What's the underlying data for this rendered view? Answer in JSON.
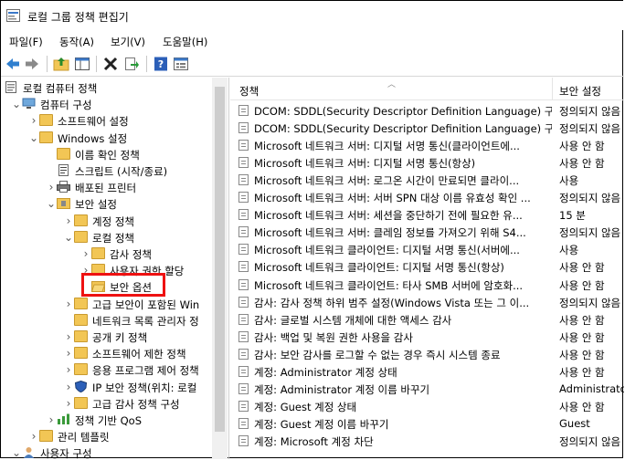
{
  "window": {
    "title": "로컬 그룹 정책 편집기"
  },
  "menu": [
    "파일(F)",
    "동작(A)",
    "보기(V)",
    "도움말(H)"
  ],
  "toolbar": [
    "back-icon",
    "forward-icon",
    "up-folder-icon",
    "show-hide-tree-icon",
    "delete-icon",
    "export-icon",
    "help-icon",
    "properties-icon"
  ],
  "tree": [
    {
      "label": "로컬 컴퓨터 정책",
      "indent": 0,
      "toggle": "",
      "icon": "computer-policy"
    },
    {
      "label": "컴퓨터 구성",
      "indent": 1,
      "toggle": "v",
      "icon": "computer"
    },
    {
      "label": "소프트웨어 설정",
      "indent": 2,
      "toggle": ">",
      "icon": "folder"
    },
    {
      "label": "Windows 설정",
      "indent": 2,
      "toggle": "v",
      "icon": "folder"
    },
    {
      "label": "이름 확인 정책",
      "indent": 3,
      "toggle": "",
      "icon": "folder"
    },
    {
      "label": "스크립트 (시작/종료)",
      "indent": 3,
      "toggle": "",
      "icon": "script"
    },
    {
      "label": "배포된 프린터",
      "indent": 3,
      "toggle": ">",
      "icon": "printer"
    },
    {
      "label": "보안 설정",
      "indent": 3,
      "toggle": "v",
      "icon": "security"
    },
    {
      "label": "계정 정책",
      "indent": 4,
      "toggle": ">",
      "icon": "folder"
    },
    {
      "label": "로컬 정책",
      "indent": 4,
      "toggle": "v",
      "icon": "folder"
    },
    {
      "label": "감사 정책",
      "indent": 5,
      "toggle": ">",
      "icon": "folder"
    },
    {
      "label": "사용자 권한 할당",
      "indent": 5,
      "toggle": ">",
      "icon": "folder"
    },
    {
      "label": "보안 옵션",
      "indent": 5,
      "toggle": "",
      "icon": "folder-open"
    },
    {
      "label": "고급 보안이 포함된 Win",
      "indent": 4,
      "toggle": ">",
      "icon": "folder"
    },
    {
      "label": "네트워크 목록 관리자 정",
      "indent": 4,
      "toggle": "",
      "icon": "folder"
    },
    {
      "label": "공개 키 정책",
      "indent": 4,
      "toggle": ">",
      "icon": "folder"
    },
    {
      "label": "소프트웨어 제한 정책",
      "indent": 4,
      "toggle": ">",
      "icon": "folder"
    },
    {
      "label": "응용 프로그램 제어 정책",
      "indent": 4,
      "toggle": ">",
      "icon": "folder"
    },
    {
      "label": "IP 보안 정책(위치: 로컬",
      "indent": 4,
      "toggle": ">",
      "icon": "ipsec"
    },
    {
      "label": "고급 감사 정책 구성",
      "indent": 4,
      "toggle": ">",
      "icon": "folder"
    },
    {
      "label": "정책 기반 QoS",
      "indent": 3,
      "toggle": ">",
      "icon": "qos"
    },
    {
      "label": "관리 템플릿",
      "indent": 2,
      "toggle": ">",
      "icon": "folder"
    },
    {
      "label": "사용자 구성",
      "indent": 1,
      "toggle": "v",
      "icon": "user"
    }
  ],
  "list": {
    "col_policy": "정책",
    "col_setting": "보안 설정",
    "rows": [
      {
        "policy": "DCOM: SDDL(Security Descriptor Definition Language) 구...",
        "setting": "정의되지 않음"
      },
      {
        "policy": "DCOM: SDDL(Security Descriptor Definition Language) 구...",
        "setting": "정의되지 않음"
      },
      {
        "policy": "Microsoft 네트워크 서버: 디지털 서명 통신(클라이언트에...",
        "setting": "사용 안 함"
      },
      {
        "policy": "Microsoft 네트워크 서버: 디지털 서명 통신(항상)",
        "setting": "사용 안 함"
      },
      {
        "policy": "Microsoft 네트워크 서버: 로그온 시간이 만료되면 클라이...",
        "setting": "사용"
      },
      {
        "policy": "Microsoft 네트워크 서버: 서버 SPN 대상 이름 유효성 확인 ...",
        "setting": "정의되지 않음"
      },
      {
        "policy": "Microsoft 네트워크 서버: 세션을 중단하기 전에 필요한 유...",
        "setting": "15 분"
      },
      {
        "policy": "Microsoft 네트워크 서버: 클레임 정보를 가져오기 위해 S4...",
        "setting": "정의되지 않음"
      },
      {
        "policy": "Microsoft 네트워크 클라이언트: 디지털 서명 통신(서버에...",
        "setting": "사용"
      },
      {
        "policy": "Microsoft 네트워크 클라이언트: 디지털 서명 통신(항상)",
        "setting": "사용 안 함"
      },
      {
        "policy": "Microsoft 네트워크 클라이언트: 타사 SMB 서버에 암호화...",
        "setting": "사용 안 함"
      },
      {
        "policy": "감사: 감사 정책 하위 범주 설정(Windows Vista 또는 그 이...",
        "setting": "정의되지 않음"
      },
      {
        "policy": "감사: 글로벌 시스템 개체에 대한 액세스 감사",
        "setting": "사용 안 함"
      },
      {
        "policy": "감사: 백업 및 복원 권한 사용을 감사",
        "setting": "사용 안 함"
      },
      {
        "policy": "감사: 보안 감사를 로그할 수 없는 경우 즉시 시스템 종료",
        "setting": "사용 안 함"
      },
      {
        "policy": "계정: Administrator 계정 상태",
        "setting": "사용 안 함"
      },
      {
        "policy": "계정: Administrator 계정 이름 바꾸기",
        "setting": "Administrator"
      },
      {
        "policy": "계정: Guest 계정 상태",
        "setting": "사용 안 함"
      },
      {
        "policy": "계정: Guest 계정 이름 바꾸기",
        "setting": "Guest"
      },
      {
        "policy": "계정: Microsoft 계정 차단",
        "setting": "정의되지 않음"
      }
    ]
  }
}
